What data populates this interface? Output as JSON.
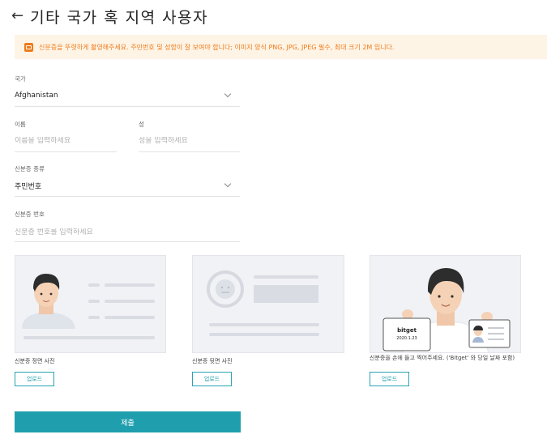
{
  "header": {
    "back_icon": "arrow-left-icon",
    "title": "기타 국가 혹 지역 사용자"
  },
  "notice": {
    "icon": "warning-icon",
    "text": "신분증을 뚜렷하게 촬영해주세요. 주민번호 및 성함이 잘 보여야 합니다;  이미지 양식 PNG, JPG, JPEG 필수, 최대 크기 2M 입니다."
  },
  "form": {
    "country": {
      "label": "국가",
      "value": "Afghanistan"
    },
    "first_name": {
      "label": "이름",
      "placeholder": "이름을 입력하세요"
    },
    "last_name": {
      "label": "성",
      "placeholder": "성을 입력하세요"
    },
    "id_type": {
      "label": "신분증 종류",
      "value": "주민번호"
    },
    "id_number": {
      "label": "신분증 번호",
      "placeholder": "신분증 번호를 입력하세요"
    }
  },
  "uploads": [
    {
      "caption": "신분증 정면 사진",
      "button": "업로드"
    },
    {
      "caption": "신분증 뒷면 사진",
      "button": "업로드"
    },
    {
      "caption": "신분증을 손에 들고 찍어주세요. ('Bitget' 와 당일 날짜 포함)",
      "button": "업로드",
      "sign_text": "bitget",
      "sign_date": "2020.1.23"
    }
  ],
  "submit_label": "제출",
  "colors": {
    "accent": "#1f9fae",
    "warning": "#f07a1a",
    "notice_bg": "#fdf4e6"
  }
}
